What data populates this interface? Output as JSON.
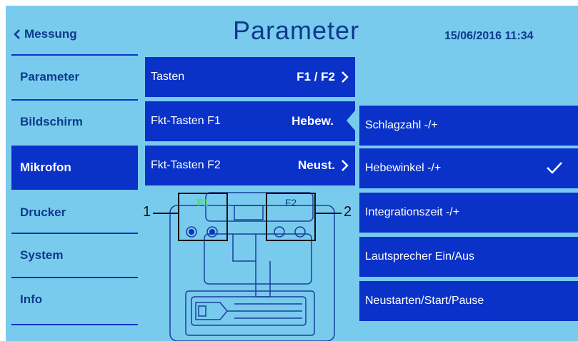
{
  "header": {
    "back_label": "Messung",
    "title": "Parameter",
    "datetime": "15/06/2016 11:34"
  },
  "sidebar": {
    "items": [
      {
        "label": "Parameter",
        "active": false
      },
      {
        "label": "Bildschirm",
        "active": false
      },
      {
        "label": "Mikrofon",
        "active": true
      },
      {
        "label": "Drucker",
        "active": false
      },
      {
        "label": "System",
        "active": false
      },
      {
        "label": "Info",
        "active": false
      }
    ]
  },
  "params": [
    {
      "label": "Tasten",
      "value": "F1 / F2",
      "icon": "chevron-right-icon"
    },
    {
      "label": "Fkt-Tasten F1",
      "value": "Hebew.",
      "icon": "selected-notch"
    },
    {
      "label": "Fkt-Tasten F2",
      "value": "Neust.",
      "icon": "chevron-right-icon"
    }
  ],
  "options": [
    {
      "label": "Schlagzahl -/+",
      "checked": false
    },
    {
      "label": "Hebewinkel -/+",
      "checked": true
    },
    {
      "label": "Integrationszeit -/+",
      "checked": false
    },
    {
      "label": "Lautsprecher Ein/Aus",
      "checked": false
    },
    {
      "label": "Neustarten/Start/Pause",
      "checked": false
    }
  ],
  "illustration": {
    "f1_label": "F1",
    "f2_label": "F2",
    "callout_1": "1",
    "callout_2": "2"
  },
  "colors": {
    "background": "#79cbee",
    "accent": "#0a32c8",
    "text_dark": "#0d3a8c",
    "f1_highlight": "#36e04a"
  }
}
